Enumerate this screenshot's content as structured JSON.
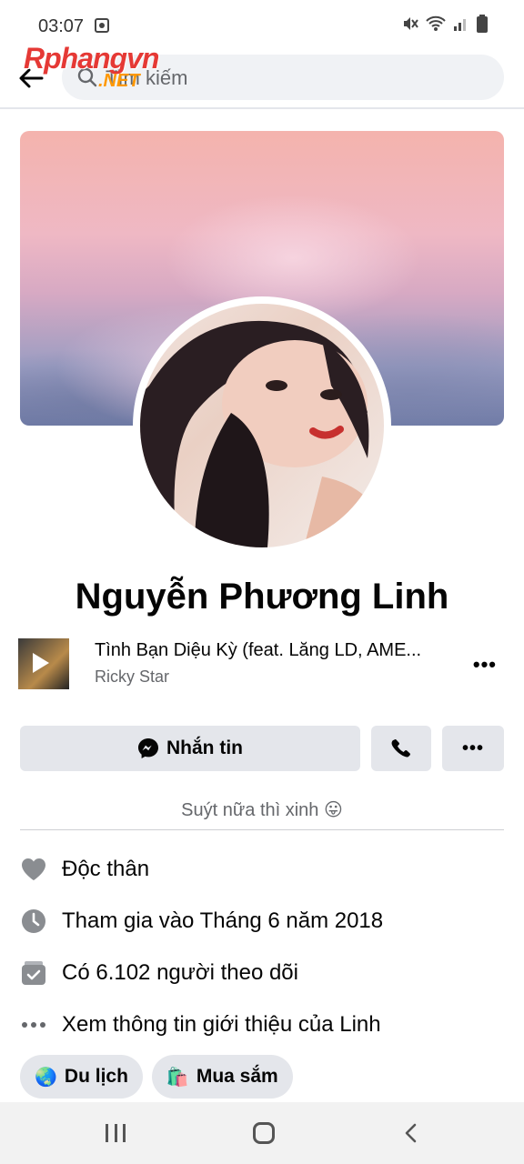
{
  "status_bar": {
    "time": "03:07"
  },
  "watermark": {
    "main": "Rphangvn",
    "sub": ".NET"
  },
  "search": {
    "placeholder": "Tìm kiếm"
  },
  "profile": {
    "name": "Nguyễn Phương Linh",
    "bio": "Suýt nữa thì xinh 😛"
  },
  "music": {
    "title": "Tình Bạn Diệu Kỳ (feat. Lăng LD, AME...",
    "artist": "Ricky Star",
    "more": "•••"
  },
  "actions": {
    "message_label": "Nhắn tin",
    "more_label": "•••"
  },
  "details": [
    {
      "icon": "heart-icon",
      "text": "Độc thân"
    },
    {
      "icon": "clock-icon",
      "text": "Tham gia vào Tháng 6 năm 2018"
    },
    {
      "icon": "followers-icon",
      "text": "Có 6.102 người theo dõi"
    },
    {
      "icon": "more-icon",
      "text": "Xem thông tin giới thiệu của Linh"
    }
  ],
  "interests": [
    {
      "emoji": "🌏",
      "label": "Du lịch"
    },
    {
      "emoji": "🛍️",
      "label": "Mua sắm"
    }
  ],
  "colors": {
    "accent": "#1877f2",
    "button_bg": "#e4e6eb",
    "secondary_text": "#65676b"
  }
}
